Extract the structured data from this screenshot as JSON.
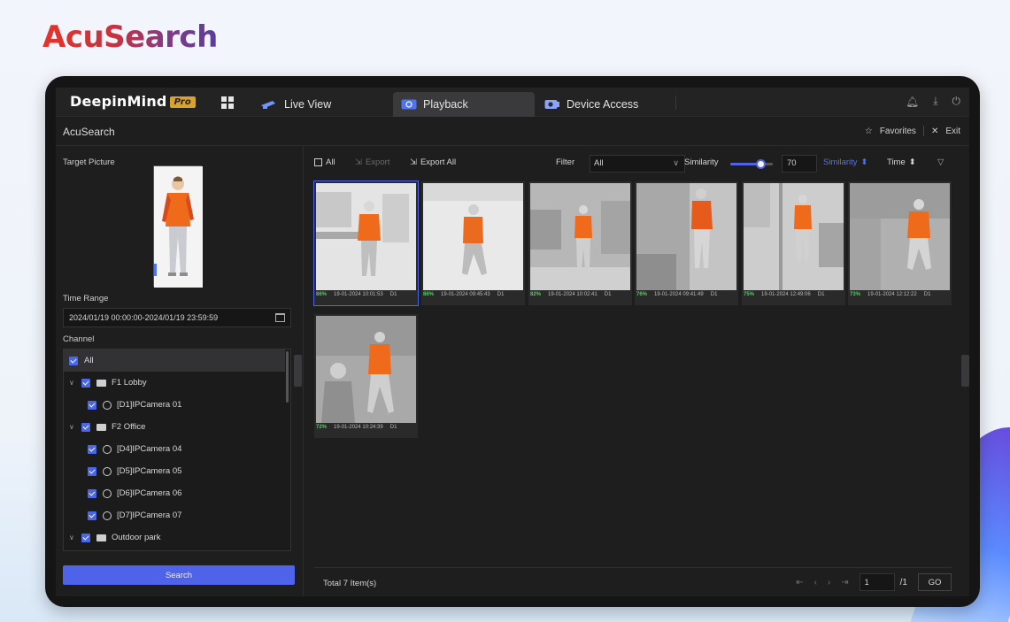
{
  "brand": "AcuSearch",
  "app": {
    "logo": "DeepinMind",
    "logo_badge": "Pro"
  },
  "nav": {
    "tabs": [
      {
        "label": "Live View",
        "icon": "camera-icon"
      },
      {
        "label": "Playback",
        "icon": "playback-icon",
        "active": true
      },
      {
        "label": "Device Access",
        "icon": "device-camera-icon"
      }
    ]
  },
  "subheader": {
    "title": "AcuSearch",
    "favorites": "Favorites",
    "exit": "Exit"
  },
  "left": {
    "target_label": "Target Picture",
    "time_label": "Time Range",
    "time_value": "2024/01/19 00:00:00-2024/01/19 23:59:59",
    "channel_label": "Channel",
    "channels": [
      {
        "label": "All",
        "level": 0,
        "type": "all"
      },
      {
        "label": "F1 Lobby",
        "level": 1,
        "type": "folder"
      },
      {
        "label": "[D1]IPCamera 01",
        "level": 2,
        "type": "camera"
      },
      {
        "label": "F2 Office",
        "level": 1,
        "type": "folder"
      },
      {
        "label": "[D4]IPCamera 04",
        "level": 2,
        "type": "camera"
      },
      {
        "label": "[D5]IPCamera 05",
        "level": 2,
        "type": "camera"
      },
      {
        "label": "[D6]IPCamera 06",
        "level": 2,
        "type": "camera"
      },
      {
        "label": "[D7]IPCamera 07",
        "level": 2,
        "type": "camera"
      },
      {
        "label": "Outdoor park",
        "level": 1,
        "type": "folder"
      }
    ],
    "search_label": "Search"
  },
  "toolbar": {
    "all": "All",
    "export": "Export",
    "export_all": "Export All",
    "filter_label": "Filter",
    "filter_value": "All",
    "similarity_label": "Similarity",
    "similarity_value": "70",
    "similarity_level": 0.7,
    "sort_similarity": "Similarity",
    "sort_time": "Time"
  },
  "results": [
    {
      "pct": "86%",
      "time": "19-01-2024 10:01:53",
      "ch": "D1"
    },
    {
      "pct": "86%",
      "time": "19-01-2024 09:45:43",
      "ch": "D1"
    },
    {
      "pct": "82%",
      "time": "19-01-2024 10:02:41",
      "ch": "D1"
    },
    {
      "pct": "76%",
      "time": "19-01-2024 09:41:49",
      "ch": "D1"
    },
    {
      "pct": "75%",
      "time": "19-01-2024 12:49:06",
      "ch": "D1"
    },
    {
      "pct": "73%",
      "time": "19-01-2024 12:12:22",
      "ch": "D1"
    },
    {
      "pct": "72%",
      "time": "19-01-2024 10:24:39",
      "ch": "D1"
    }
  ],
  "footer": {
    "total": "Total 7 Item(s)",
    "page": "1",
    "page_total": "/1",
    "go": "GO"
  },
  "colors": {
    "accent": "#4e63ea",
    "match": "#4bd35a",
    "shirt": "#f06a1c"
  }
}
